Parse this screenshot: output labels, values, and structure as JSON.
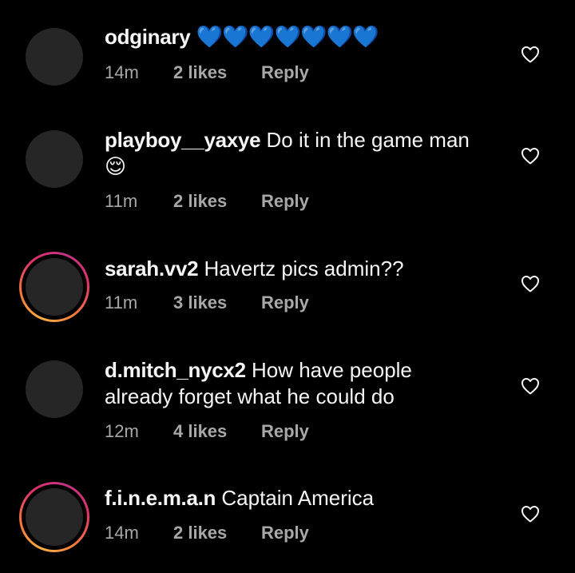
{
  "comments": [
    {
      "username": "odginary",
      "text": "💙💙💙💙💙💙💙",
      "time": "14m",
      "likes": "2 likes",
      "reply": "Reply",
      "story_ring": false
    },
    {
      "username": "playboy__yaxye",
      "text": "Do it in the game man 😌",
      "time": "11m",
      "likes": "2 likes",
      "reply": "Reply",
      "story_ring": false
    },
    {
      "username": "sarah.vv2",
      "text": "Havertz pics admin??",
      "time": "11m",
      "likes": "3 likes",
      "reply": "Reply",
      "story_ring": true
    },
    {
      "username": "d.mitch_nycx2",
      "text": "How have people already forget what he could do",
      "time": "12m",
      "likes": "4 likes",
      "reply": "Reply",
      "story_ring": false
    },
    {
      "username": "f.i.n.e.m.a.n",
      "text": "Captain America",
      "time": "14m",
      "likes": "2 likes",
      "reply": "Reply",
      "story_ring": true
    }
  ],
  "icons": {
    "like": "heart-outline-icon"
  },
  "colors": {
    "background": "#000000",
    "meta_text": "#a8a8a8",
    "avatar": "#262626"
  }
}
